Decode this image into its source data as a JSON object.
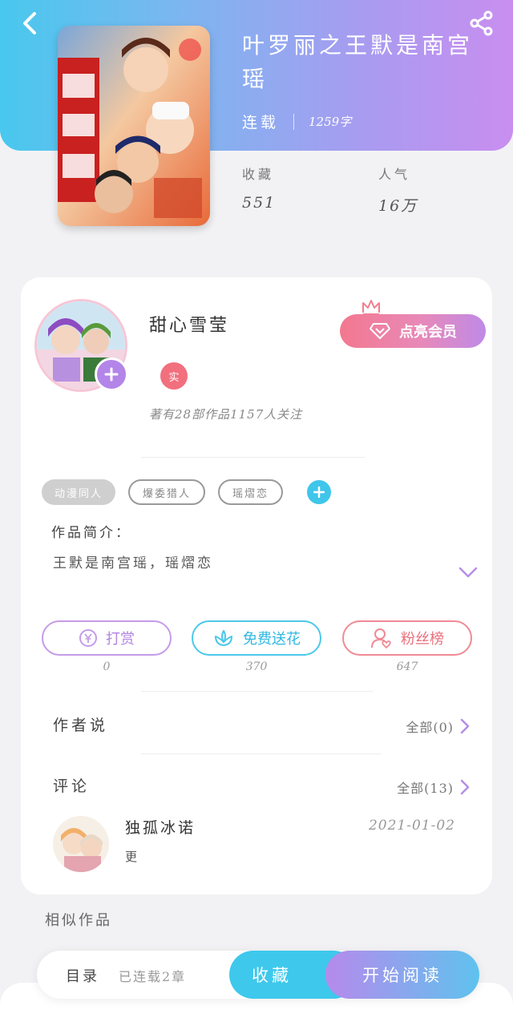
{
  "book": {
    "title": "叶罗丽之王默是南宫瑶",
    "status": "连载",
    "word_count": "1259字",
    "favorites_label": "收藏",
    "favorites_value": "551",
    "popularity_label": "人气",
    "popularity_value": "16万",
    "cover_alt": "book-cover"
  },
  "author": {
    "name": "甜心雪莹",
    "verified_badge": "实",
    "stats": "著有28部作品1157人关注",
    "vip_button": "点亮会员"
  },
  "tags": [
    "动漫同人",
    "爆委猎人",
    "瑶熠恋"
  ],
  "intro": {
    "title": "作品简介：",
    "text": "王默是南宫瑶，瑶熠恋"
  },
  "actions": [
    {
      "label": "打赏",
      "count": "0",
      "color": "#b084e0"
    },
    {
      "label": "免费送花",
      "count": "370",
      "color": "#2fb8e0"
    },
    {
      "label": "粉丝榜",
      "count": "647",
      "color": "#ea6f7c"
    }
  ],
  "author_says": {
    "title": "作者说",
    "link": "全部(0)"
  },
  "comments": {
    "title": "评论",
    "link": "全部(13)",
    "items": [
      {
        "user": "独孤冰诺",
        "text": "更",
        "date": "2021-01-02"
      }
    ]
  },
  "similar": {
    "title": "相似作品"
  },
  "bottom_bar": {
    "catalog": "目录",
    "chapters": "已连载2章",
    "favorite": "收藏",
    "read": "开始阅读"
  },
  "colors": {
    "header_start": "#48c8ee",
    "header_end": "#c98ef0",
    "vip": "#f3788f",
    "accent_blue": "#3ec8ec",
    "accent_purple": "#b385e8"
  }
}
